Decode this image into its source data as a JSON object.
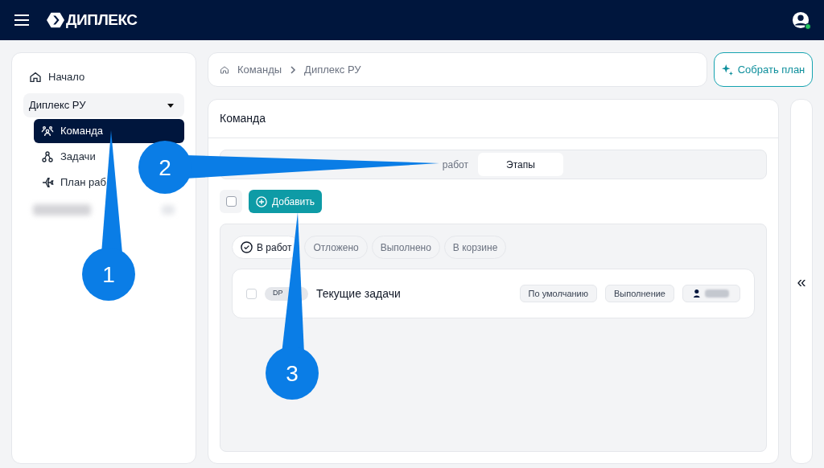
{
  "header": {
    "logo": "ДИПЛЕКС"
  },
  "sidebar": {
    "items": [
      {
        "label": "Начало",
        "kind": "link"
      },
      {
        "label": "Диплекс РУ",
        "kind": "group",
        "expanded": true,
        "children": [
          {
            "label": "Команда",
            "selected": true
          },
          {
            "label": "Задачи",
            "selected": false
          },
          {
            "label": "План раб",
            "selected": false
          }
        ]
      }
    ]
  },
  "breadcrumb": [
    "Команды",
    "Диплекс РУ"
  ],
  "plan_button": "Собрать план",
  "panel": {
    "title": "Команда",
    "tabs": [
      {
        "label": "работ",
        "selected": false
      },
      {
        "label": "Этапы",
        "selected": true
      }
    ],
    "select_all": {
      "checked": false
    },
    "add_button": "Добавить",
    "filters": [
      {
        "label": "В работ",
        "selected": true
      },
      {
        "label": "Отложено",
        "selected": false
      },
      {
        "label": "Выполнено",
        "selected": false
      },
      {
        "label": "В корзине",
        "selected": false
      }
    ],
    "rows": [
      {
        "checked": false,
        "code": "DP",
        "title": "Текущие задачи",
        "tags": [
          "По умолчанию",
          "Выполнение"
        ]
      }
    ]
  },
  "collapse_button": "«",
  "callouts": [
    "1",
    "2",
    "3"
  ]
}
